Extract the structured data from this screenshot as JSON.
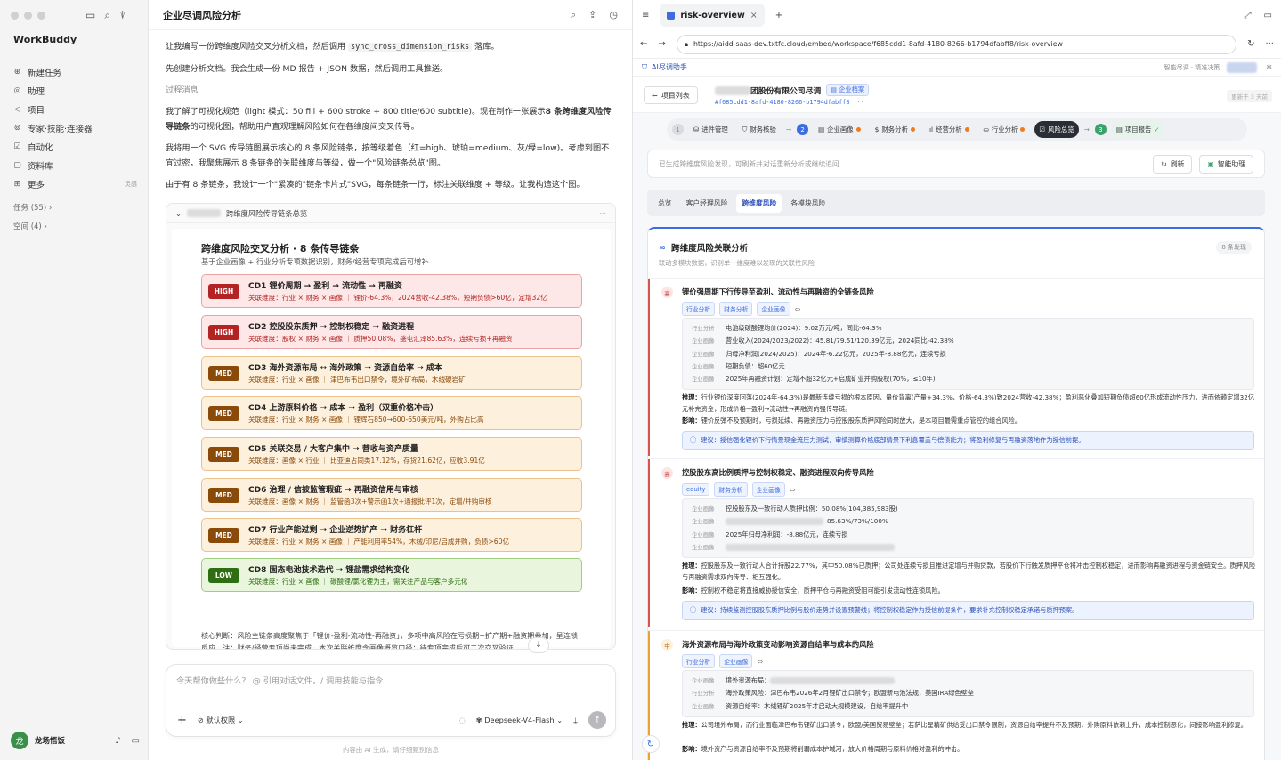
{
  "sidebar": {
    "brand": "WorkBuddy",
    "items": [
      {
        "icon": "⊕",
        "label": "新建任务"
      },
      {
        "icon": "◎",
        "label": "助理"
      },
      {
        "icon": "◁",
        "label": "项目"
      },
      {
        "icon": "⊚",
        "label": "专家·技能·连接器"
      },
      {
        "icon": "☑",
        "label": "自动化"
      },
      {
        "icon": "▢",
        "label": "资料库"
      },
      {
        "icon": "⊞",
        "label": "更多"
      }
    ],
    "more_tag": "灵感",
    "groups": [
      "任务 (55)",
      "空间 (4)"
    ],
    "user_initial": "龙",
    "user_name": "龙场悟饭"
  },
  "chat": {
    "title": "企业尽调风险分析",
    "p1_pre": "让我编写一份跨维度风险交叉分析文档，然后调用 ",
    "p1_code": "sync_cross_dimension_risks",
    "p1_post": " 落库。",
    "p2": "先创建分析文档。我会生成一份 MD 报告 + JSON 数据，然后调用工具推送。",
    "p3": "过程消息",
    "p4_a": "我了解了可视化规范（light 模式：50 fill + 600 stroke + 800 title/600 subtitle)。现在制作一张展示",
    "p4_b": "8 条跨维度风险传导链条",
    "p4_c": "的可视化图，帮助用户直观理解风险如何在各维度间交叉传导。",
    "p5": "我将用一个 SVG 传导链图展示核心的 8 条风险链条，按等级着色（红=high、琥珀=medium、灰/绿=low)。考虑到图不宜过密，我聚焦展示 8 条链条的关联维度与等级，做一个\"风险链条总览\"图。",
    "p6": "由于有 8 条链条，我设计一个\"紧凑的\"链条卡片式\"SVG，每条链条一行，标注关联维度 + 等级。让我构造这个图。",
    "card_title": "跨维度风险传导链条总览",
    "svg_title": "跨维度风险交叉分析 · 8 条传导链条",
    "svg_sub": "基于企业画像 + 行业分析专项数据识别，财务/经营专项完成后可增补",
    "chains": [
      {
        "level": "HIGH",
        "cls": "high",
        "title": "CD1 锂价周期 → 盈利 → 流动性 → 再融资",
        "desc": "关联维度：行业 × 财务 × 画像 ｜ 锂价-64.3%，2024营收-42.38%，短期负债>60亿，定增32亿"
      },
      {
        "level": "HIGH",
        "cls": "high",
        "title": "CD2 控股股东质押 → 控制权稳定 → 融资进程",
        "desc": "关联维度：股权 × 财务 × 画像 ｜ 质押50.08%，盛屯汇泽85.63%，连续亏损+再融资"
      },
      {
        "level": "MED",
        "cls": "med",
        "title": "CD3 海外资源布局 ↔ 海外政策 → 资源自给率 → 成本",
        "desc": "关联维度：行业 × 画像 ｜ 津巴布韦出口禁令，境外矿布局，木绒硬岩矿"
      },
      {
        "level": "MED",
        "cls": "med",
        "title": "CD4 上游原料价格 → 成本 → 盈利（双重价格冲击）",
        "desc": "关联维度：行业 × 财务 × 画像 ｜ 锂辉石850→600-650美元/吨，外购占比高"
      },
      {
        "level": "MED",
        "cls": "med",
        "title": "CD5 关联交易 / 大客户集中 → 营收与资产质量",
        "desc": "关联维度：画像 × 行业 ｜ 比亚迪占同类17.12%，存货21.62亿，应收3.91亿"
      },
      {
        "level": "MED",
        "cls": "med",
        "title": "CD6 治理 / 信披监管瑕疵 → 再融资信用与审核",
        "desc": "关联维度：画像 × 财务 ｜ 监管函3次+警示函1次+通报批评1次，定增/并购审核"
      },
      {
        "level": "MED",
        "cls": "med",
        "title": "CD7 行业产能过剩 → 企业逆势扩产 → 财务杠杆",
        "desc": "关联维度：行业 × 财务 × 画像 ｜ 产能利用率54%，木绒/印尼/启成并购，负债>60亿"
      },
      {
        "level": "LOW",
        "cls": "low",
        "title": "CD8 固态电池技术迭代 → 锂盐需求结构变化",
        "desc": "关联维度：行业 × 画像 ｜ 碳酸锂/氯化锂为主，需关注产品与客户多元化"
      }
    ],
    "conclusion": "核心判断：风险主链条高度聚焦于「锂价-盈利-流动性-再融资」，多项中高风险在亏损期+扩产期+融资期叠加，呈连锁反应。注：财务/经营专项尚未完成，本次关联维度含画像概览口径；待专项完成后可二次交叉验证。",
    "input_placeholder": "今天帮你做些什么？ @ 引用对话文件，/ 调用技能与指令",
    "permission": "默认权限",
    "model": "Deepseek-V4-Flash",
    "footer": "内容由 AI 生成，请仔细甄别信息"
  },
  "browser": {
    "tab_title": "risk-overview",
    "url": "https://aidd-saas-dev.txtfc.cloud/embed/workspace/f685cdd1-8afd-4180-8266-b1794dfabff8/risk-overview",
    "ext_label": "AI尽调助手",
    "ext_right": "智能尽调 · 精准决策",
    "back_label": "项目列表",
    "company_suffix": "团股份有限公司尽调",
    "doc_badge": "企业档案",
    "company_id": "#f685cdd1-8afd-4180-8266-b1794dfabff8",
    "updated": "更新于 3 天前",
    "pipeline": {
      "g1": "进件管理",
      "g2": "财务核验",
      "g3": [
        "企业画像",
        "财务分析",
        "经营分析",
        "行业分析"
      ],
      "active": "风险总览",
      "n1": "1",
      "n2": "2",
      "n3": "3",
      "report": "项目报告"
    },
    "notice": "已生成跨维度风险发现，可刷新并对话重新分析或继续追问",
    "refresh": "刷新",
    "assist": "智能助理",
    "subtabs": [
      "总览",
      "客户经理风险",
      "跨维度风险",
      "各模块风险"
    ],
    "panel_title": "跨维度风险关联分析",
    "panel_sub": "联动多模块数据，识别单一维度难以发现的关联性风险",
    "count": "8 条发现",
    "risks": [
      {
        "level": "高",
        "title": "锂价强周期下行传导至盈利、流动性与再融资的全链条风险",
        "tags": [
          "行业分析",
          "财务分析",
          "企业画像"
        ],
        "rows": [
          {
            "k": "行业分析",
            "v": "电池级碳酸锂均价(2024)：9.02万元/吨，同比-64.3%"
          },
          {
            "k": "企业画像",
            "v": "营业收入(2024/2023/2022)：45.81/79.51/120.39亿元，2024同比-42.38%"
          },
          {
            "k": "企业画像",
            "v": "归母净利润(2024/2025)：2024年-6.22亿元，2025年-8.88亿元，连续亏损"
          },
          {
            "k": "企业画像",
            "v": "短期负债：超60亿元"
          },
          {
            "k": "企业画像",
            "v": "2025年再融资计划：定增不超32亿元+启成矿业并购股权(70%，≤10年)"
          }
        ],
        "infer_label": "推理：",
        "infer": "行业锂价深度回落(2024年-64.3%)是最新连续亏损的根本原因，量价背离(产量+34.3%，价格-64.3%)致2024营收-42.38%；盈利恶化叠加短期负债超60亿形成流动性压力，进而依赖定增32亿元补充资金，形成价格→盈利→流动性→再融资的强传导链。",
        "impact_label": "影响：",
        "impact": "锂价反弹不及预期时，亏损延续、再融资压力与控股股东质押风险同时放大，是本项目最需重点管控的组合风险。",
        "advice": "建议：授信强化锂价下行情景现金流压力测试，审慎测算价格底部情景下利息覆盖与偿债能力；将盈利修复与再融资落地作为授信前提。"
      },
      {
        "level": "高",
        "title": "控股股东高比例质押与控制权稳定、融资进程双向传导风险",
        "tags": [
          "equity",
          "财务分析",
          "企业画像"
        ],
        "rows": [
          {
            "k": "企业画像",
            "v": "控股股东及一致行动人质押比例：50.08%(104,385,983股)"
          },
          {
            "k": "企业画像",
            "v": "85.63%/73%/100%"
          },
          {
            "k": "企业画像",
            "v": "2025年归母净利润：-8.88亿元，连续亏损"
          },
          {
            "k": "企业画像",
            "v": ""
          }
        ],
        "infer_label": "推理：",
        "infer": "控股股东及一致行动人合计持股22.77%，其中50.08%已质押；公司处连续亏损且推进定增与并购贷款，若股价下行触发质押平仓将冲击控制权稳定，进而影响再融资进程与资金链安全。质押风险与再融资需求双向传导、相互强化。",
        "impact_label": "影响：",
        "impact": "控制权不稳定将直接威胁授信安全，质押平仓与再融资受阻可能引发流动性连锁风险。",
        "advice": "建议：持续监测控股股东质押比例与股价走势并设置预警线；将控制权稳定作为授信前提条件，要求补充控制权稳定承诺与质押预案。"
      },
      {
        "level": "中",
        "title": "海外资源布局与海外政策变动影响资源自给率与成本的风险",
        "tags": [
          "行业分析",
          "企业画像"
        ],
        "rows": [
          {
            "k": "企业画像",
            "v": "境外资源布局："
          },
          {
            "k": "行业分析",
            "v": "海外政策风险：津巴布韦2026年2月锂矿出口禁令；欧盟新电池法规，美国IRA绿色壁垒"
          },
          {
            "k": "企业画像",
            "v": "资源自给率：木绒锂矿2025年才启动大规模建设，自给率提升中"
          }
        ],
        "infer_label": "推理：",
        "infer": "公司境外布局，而行业面临津巴布韦锂矿出口禁令，欧盟/美国贸易壁垒；若萨比星精矿供给受出口禁令限制，资源自给率提升不及预期，外购原料依赖上升，成本控制恶化，间接影响盈利修复。",
        "impact_label": "影响：",
        "impact": "境外资产与资源自给率不及预期将削弱成本护城河，放大价格周期与原料价格对盈利的冲击。"
      }
    ]
  }
}
